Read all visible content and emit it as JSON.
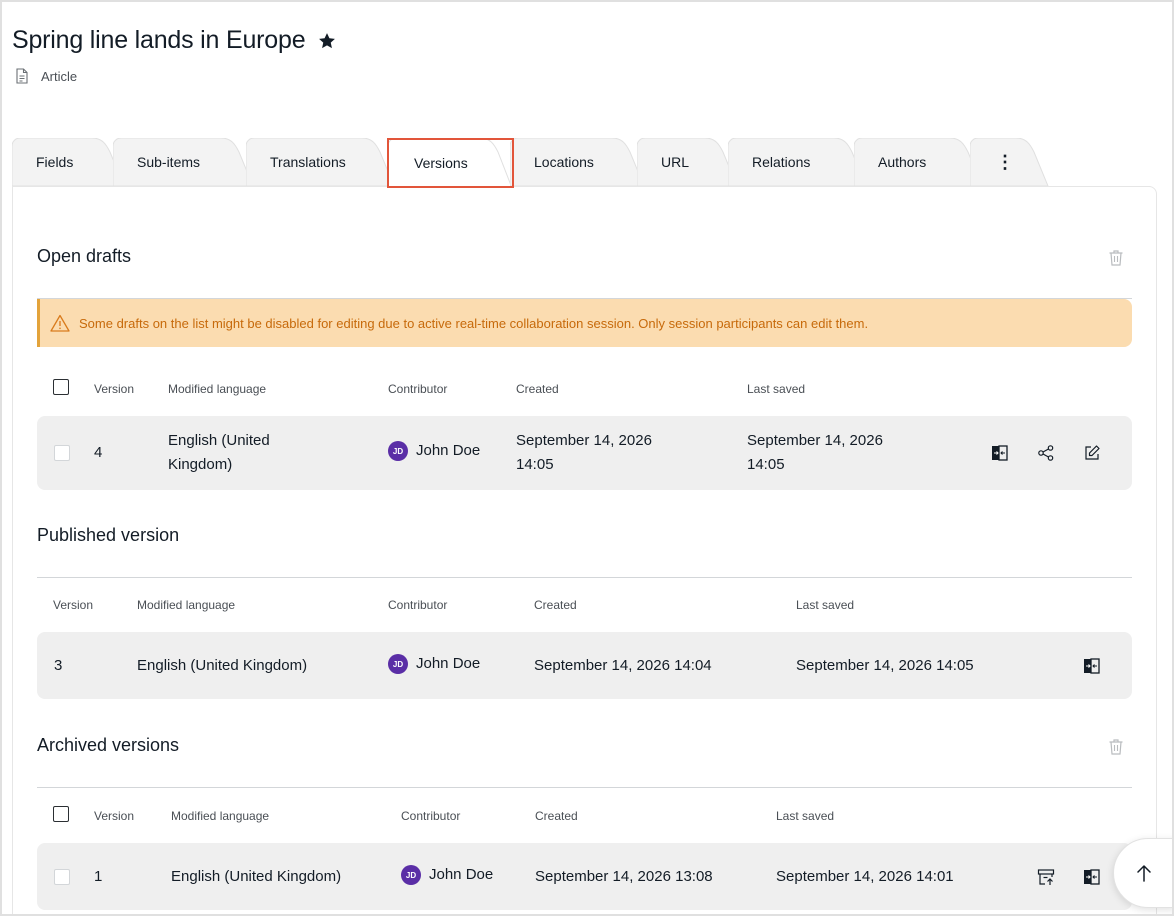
{
  "header": {
    "title": "Spring line lands in Europe",
    "content_type": "Article"
  },
  "tabs": [
    {
      "label": "Fields"
    },
    {
      "label": "Sub-items"
    },
    {
      "label": "Translations"
    },
    {
      "label": "Versions",
      "active": true
    },
    {
      "label": "Locations"
    },
    {
      "label": "URL"
    },
    {
      "label": "Relations"
    },
    {
      "label": "Authors"
    },
    {
      "label": "⋮"
    }
  ],
  "colors": {
    "accent_red": "#e2553a",
    "alert_bg": "#fbdcb0",
    "alert_text": "#c76a0b",
    "avatar_bg": "#5a2ea6",
    "row_bg": "#efefef"
  },
  "open_drafts": {
    "title": "Open drafts",
    "alert": "Some drafts on the list might be disabled for editing due to active real-time collaboration session. Only session participants can edit them.",
    "columns": [
      "Version",
      "Modified language",
      "Contributor",
      "Created",
      "Last saved"
    ],
    "rows": [
      {
        "version": "4",
        "language_line1": "English (United",
        "language_line2": "Kingdom)",
        "initials": "JD",
        "contributor": "John Doe",
        "created_line1": "September 14, 2026",
        "created_line2": "14:05",
        "saved_line1": "September 14, 2026",
        "saved_line2": "14:05"
      }
    ]
  },
  "published": {
    "title": "Published version",
    "columns": [
      "Version",
      "Modified language",
      "Contributor",
      "Created",
      "Last saved"
    ],
    "rows": [
      {
        "version": "3",
        "language": "English (United Kingdom)",
        "initials": "JD",
        "contributor": "John Doe",
        "created": "September 14, 2026 14:04",
        "saved": "September 14, 2026 14:05"
      }
    ]
  },
  "archived": {
    "title": "Archived versions",
    "columns": [
      "Version",
      "Modified language",
      "Contributor",
      "Created",
      "Last saved"
    ],
    "rows": [
      {
        "version": "1",
        "language": "English (United Kingdom)",
        "initials": "JD",
        "contributor": "John Doe",
        "created": "September 14, 2026 13:08",
        "saved": "September 14, 2026 14:01"
      }
    ]
  }
}
